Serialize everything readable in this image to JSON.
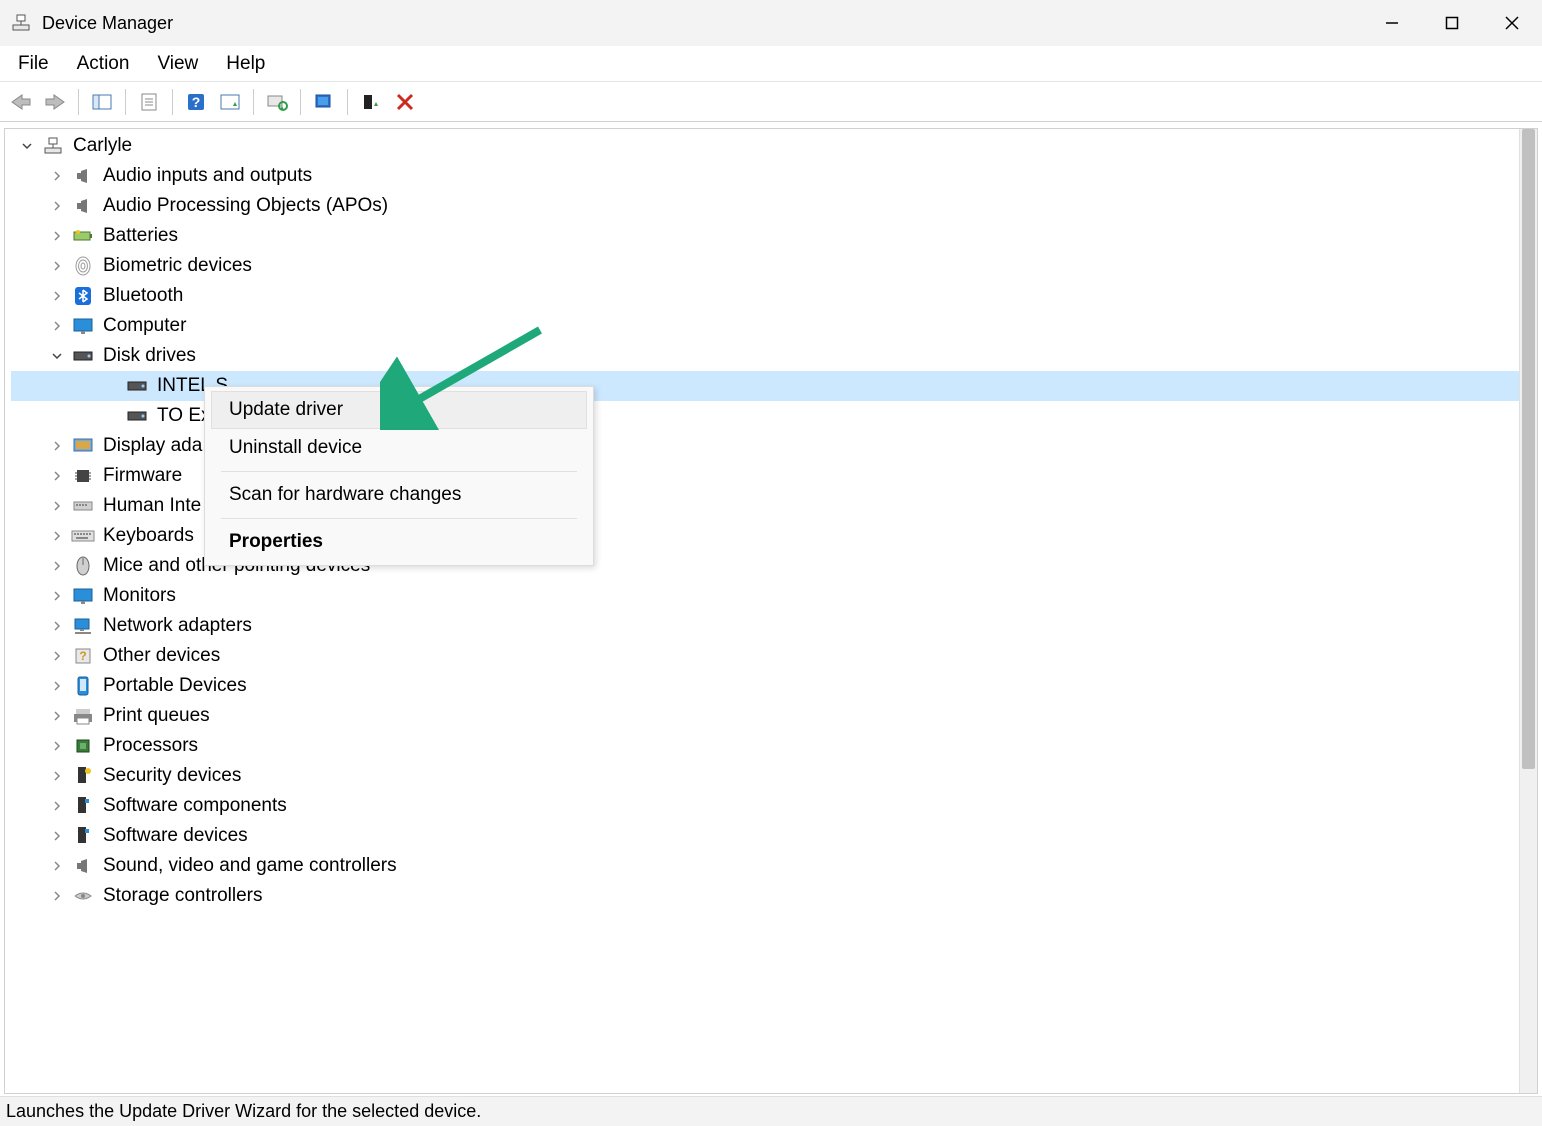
{
  "window": {
    "title": "Device Manager"
  },
  "menubar": {
    "file": "File",
    "action": "Action",
    "view": "View",
    "help": "Help"
  },
  "toolbar": {
    "back": "Back",
    "forward": "Forward",
    "show_hide_console": "Show/Hide Console Tree",
    "properties": "Properties",
    "help": "Help",
    "update_driver": "Update Driver",
    "scan_hardware": "Scan for hardware changes",
    "uninstall_device": "Uninstall device",
    "add_driver": "Add drivers",
    "disable_device": "Disable device"
  },
  "tree": {
    "root": "Carlyle",
    "categories": [
      {
        "label": "Audio inputs and outputs",
        "icon": "speaker"
      },
      {
        "label": "Audio Processing Objects (APOs)",
        "icon": "speaker"
      },
      {
        "label": "Batteries",
        "icon": "battery"
      },
      {
        "label": "Biometric devices",
        "icon": "fingerprint"
      },
      {
        "label": "Bluetooth",
        "icon": "bluetooth"
      },
      {
        "label": "Computer",
        "icon": "monitor"
      },
      {
        "label": "Disk drives",
        "icon": "disk",
        "expanded": true,
        "children": [
          {
            "label": "INTEL S",
            "icon": "disk",
            "selected": true
          },
          {
            "label": "TO Exte",
            "icon": "disk"
          }
        ]
      },
      {
        "label": "Display ada",
        "icon": "display"
      },
      {
        "label": "Firmware",
        "icon": "chip"
      },
      {
        "label": "Human Inte",
        "icon": "hid"
      },
      {
        "label": "Keyboards",
        "icon": "keyboard"
      },
      {
        "label": "Mice and other pointing devices",
        "icon": "mouse"
      },
      {
        "label": "Monitors",
        "icon": "monitor"
      },
      {
        "label": "Network adapters",
        "icon": "network"
      },
      {
        "label": "Other devices",
        "icon": "unknown"
      },
      {
        "label": "Portable Devices",
        "icon": "phone"
      },
      {
        "label": "Print queues",
        "icon": "printer"
      },
      {
        "label": "Processors",
        "icon": "cpu"
      },
      {
        "label": "Security devices",
        "icon": "security"
      },
      {
        "label": "Software components",
        "icon": "software"
      },
      {
        "label": "Software devices",
        "icon": "software"
      },
      {
        "label": "Sound, video and game controllers",
        "icon": "speaker"
      },
      {
        "label": "Storage controllers",
        "icon": "storage"
      }
    ]
  },
  "context_menu": {
    "update_driver": "Update driver",
    "uninstall_device": "Uninstall device",
    "scan_hardware": "Scan for hardware changes",
    "properties": "Properties"
  },
  "statusbar": {
    "text": "Launches the Update Driver Wizard for the selected device."
  }
}
